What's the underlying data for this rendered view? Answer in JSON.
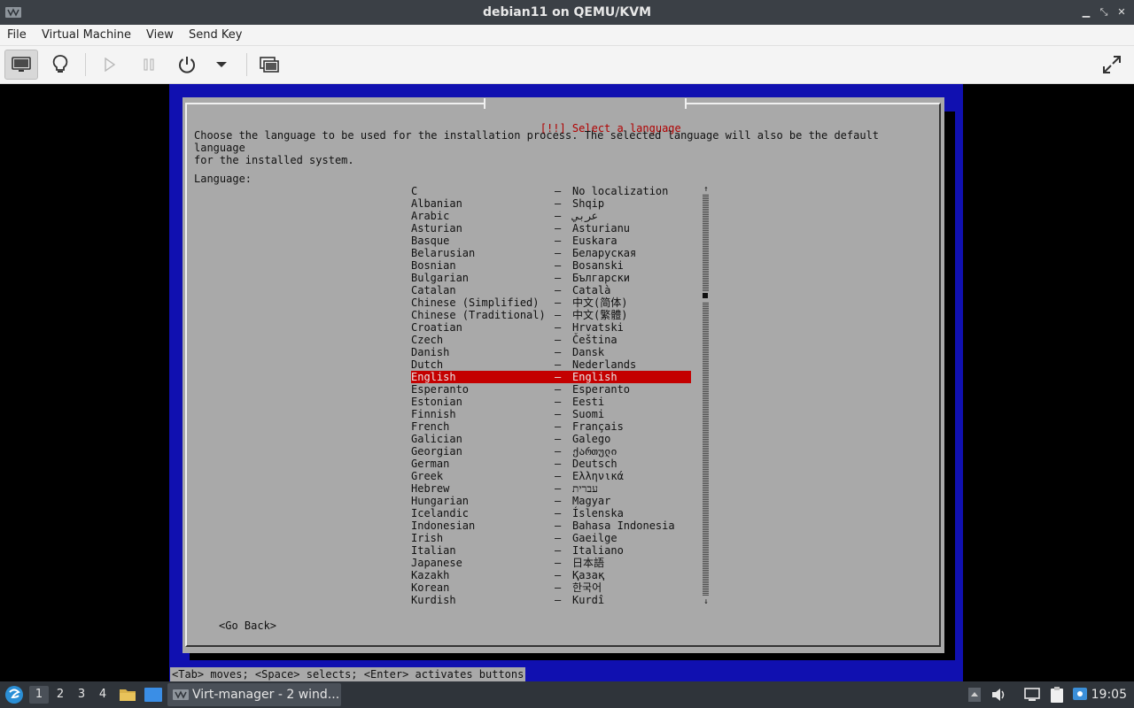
{
  "window": {
    "title": "debian11 on QEMU/KVM"
  },
  "menu": [
    "File",
    "Virtual Machine",
    "View",
    "Send Key"
  ],
  "toolbar": {
    "buttons": [
      "display-console-icon",
      "details-lightbulb-icon",
      "run-play-icon",
      "pause-icon",
      "power-icon",
      "dropdown-arrow-icon",
      "snapshots-icon",
      "fullscreen-expand-icon"
    ]
  },
  "installer": {
    "dialog_title": "[!!] Select a language",
    "description": "Choose the language to be used for the installation process. The selected language will also be the default language\nfor the installed system.",
    "language_label": "Language:",
    "languages": [
      {
        "name": "C",
        "native": "No localization"
      },
      {
        "name": "Albanian",
        "native": "Shqip"
      },
      {
        "name": "Arabic",
        "native": "عربي"
      },
      {
        "name": "Asturian",
        "native": "Asturianu"
      },
      {
        "name": "Basque",
        "native": "Euskara"
      },
      {
        "name": "Belarusian",
        "native": "Беларуская"
      },
      {
        "name": "Bosnian",
        "native": "Bosanski"
      },
      {
        "name": "Bulgarian",
        "native": "Български"
      },
      {
        "name": "Catalan",
        "native": "Català"
      },
      {
        "name": "Chinese (Simplified)",
        "native": "中文(简体)"
      },
      {
        "name": "Chinese (Traditional)",
        "native": "中文(繁體)"
      },
      {
        "name": "Croatian",
        "native": "Hrvatski"
      },
      {
        "name": "Czech",
        "native": "Čeština"
      },
      {
        "name": "Danish",
        "native": "Dansk"
      },
      {
        "name": "Dutch",
        "native": "Nederlands"
      },
      {
        "name": "English",
        "native": "English",
        "selected": true
      },
      {
        "name": "Esperanto",
        "native": "Esperanto"
      },
      {
        "name": "Estonian",
        "native": "Eesti"
      },
      {
        "name": "Finnish",
        "native": "Suomi"
      },
      {
        "name": "French",
        "native": "Français"
      },
      {
        "name": "Galician",
        "native": "Galego"
      },
      {
        "name": "Georgian",
        "native": "ქართული"
      },
      {
        "name": "German",
        "native": "Deutsch"
      },
      {
        "name": "Greek",
        "native": "Ελληνικά"
      },
      {
        "name": "Hebrew",
        "native": "עברית"
      },
      {
        "name": "Hungarian",
        "native": "Magyar"
      },
      {
        "name": "Icelandic",
        "native": "Íslenska"
      },
      {
        "name": "Indonesian",
        "native": "Bahasa Indonesia"
      },
      {
        "name": "Irish",
        "native": "Gaeilge"
      },
      {
        "name": "Italian",
        "native": "Italiano"
      },
      {
        "name": "Japanese",
        "native": "日本語"
      },
      {
        "name": "Kazakh",
        "native": "Қазақ"
      },
      {
        "name": "Korean",
        "native": "한국어"
      },
      {
        "name": "Kurdish",
        "native": "Kurdî"
      }
    ],
    "separator": "–",
    "go_back": "<Go Back>",
    "help_line": "<Tab> moves; <Space> selects; <Enter> activates buttons"
  },
  "taskbar": {
    "workspaces": [
      "1",
      "2",
      "3",
      "4"
    ],
    "active_workspace": "1",
    "task_label": "Virt-manager - 2 wind...",
    "clock": "19:05"
  },
  "colors": {
    "installer_blue": "#1010b0",
    "dialog_gray": "#a9a9a9",
    "selection_red": "#c40000",
    "title_red": "#b00000"
  }
}
